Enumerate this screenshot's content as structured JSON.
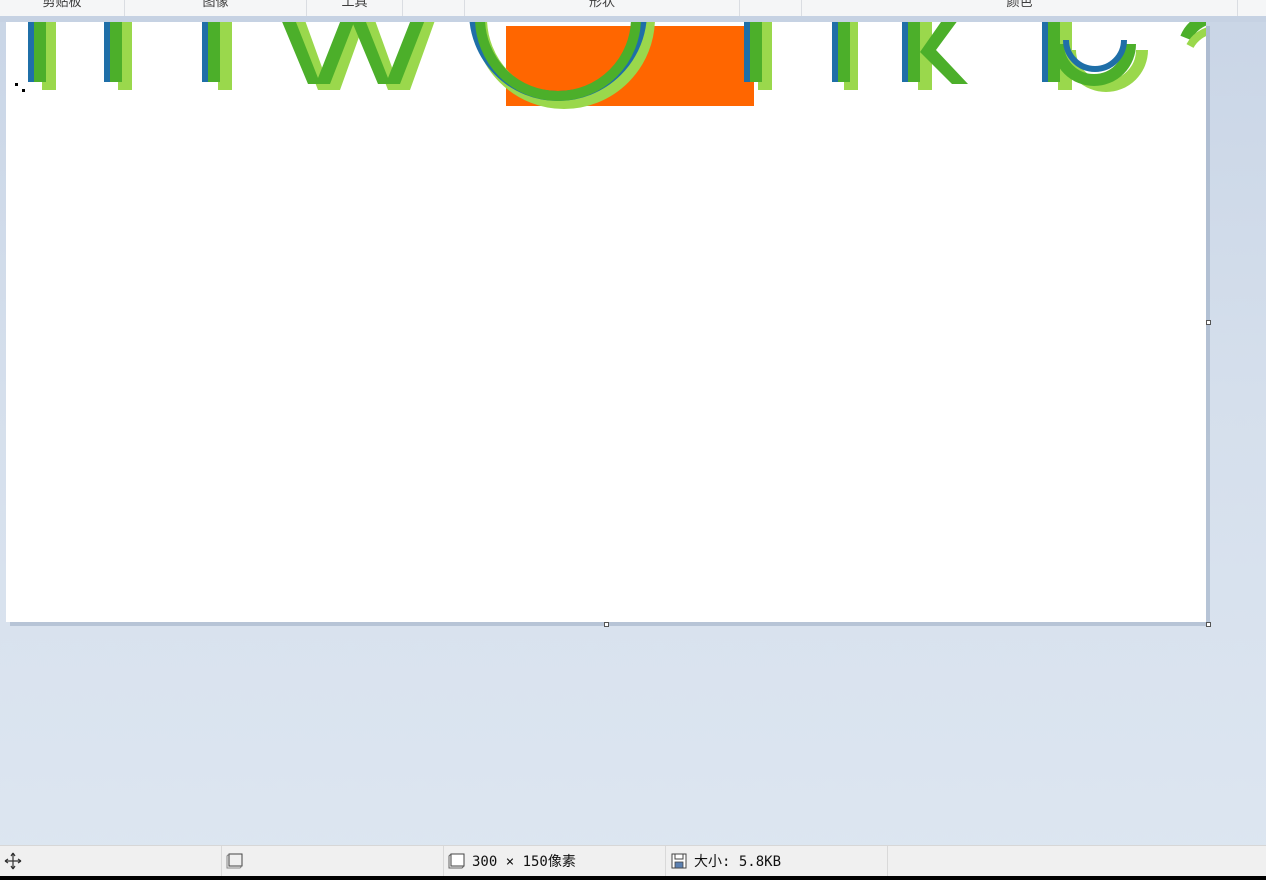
{
  "ribbon": {
    "groups": [
      {
        "label": "剪贴板"
      },
      {
        "label": "图像"
      },
      {
        "label": "工具"
      },
      {
        "label": ""
      },
      {
        "label": "形状"
      },
      {
        "label": ""
      },
      {
        "label": "颜色"
      }
    ]
  },
  "canvas": {
    "background": "#ffffff",
    "accent_orange": "#ff6600",
    "text_green": "#4caf2a",
    "text_blue": "#1f6fa8",
    "text_lightgreen": "#9ad84c"
  },
  "statusbar": {
    "move_icon": "move-cross-icon",
    "selection_icon": "selection-rect-icon",
    "dimensions_icon": "canvas-size-icon",
    "dimensions": "300 × 150像素",
    "size_icon": "save-disk-icon",
    "file_size": "大小: 5.8KB"
  }
}
